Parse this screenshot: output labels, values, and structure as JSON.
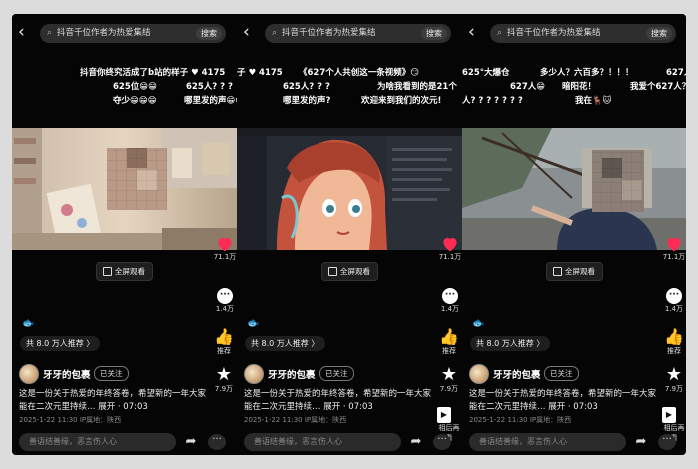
{
  "panels": [
    {
      "search": {
        "text": "抖音千位作者为热爱集结",
        "button": "搜索"
      },
      "danmu": [
        "抖音你终究活成了b站的样子 ♥ 4175",
        "625位😁😁",
        "夺少😁😁😁"
      ],
      "danmu_right": [
        "625人? ? ?",
        "哪里发的声😁😁"
      ],
      "fullscreen": "全屏观看",
      "rail": {
        "likes": "71.1万",
        "comments": "1.4万",
        "recommend": "推荐",
        "stars": "7.9万"
      },
      "fish": "🐟",
      "recommend_count": "共 8.0 万人推荐 〉",
      "author": "牙牙的包裹",
      "follow": "已关注",
      "desc": "这是一份关于热爱的年终答卷，希望新的一年大家能在二次元里持续…  展开  · 07:03",
      "meta": "2025-1-22 11:30  IP属地：陕西",
      "comment_placeholder": "善语结善缘，恶言伤人心"
    },
    {
      "search": {
        "text": "抖音千位作者为热爱集结",
        "button": "搜索"
      },
      "danmu": [
        "子 ♥ 4175",
        "625人? ? ?",
        "哪里发的声?"
      ],
      "danmu_right": [
        "《627个人共创这一条视频》😏",
        "为啥我看到的是21个",
        "欢迎来到我们的次元!"
      ],
      "fullscreen": "全屏观看",
      "rail": {
        "likes": "71.1万",
        "comments": "1.4万",
        "recommend": "推荐",
        "stars": "7.9万",
        "replay": "相后再看"
      },
      "fish": "🐟",
      "recommend_count": "共 8.0 万人推荐 〉",
      "author": "牙牙的包裹",
      "follow": "已关注",
      "desc": "这是一份关于热爱的年终答卷，希望新的一年大家能在二次元里持续…  展开  · 07:03",
      "meta": "2025-1-22 11:30  IP属地：陕西",
      "comment_placeholder": "善语结善缘，恶言伤人心"
    },
    {
      "search": {
        "text": "抖音千位作者为热爱集结",
        "button": "搜索"
      },
      "danmu": [
        "625°大爆仓",
        "多少人？六百多？！！！",
        "627人😁",
        "暗阳花！",
        "人? ? ? ? ? ? ?",
        "我在🦌🐱"
      ],
      "danmu_right": [
        "627人?",
        "我爱个627人？"
      ],
      "fullscreen": "全屏观看",
      "rail": {
        "likes": "71.1万",
        "comments": "1.4万",
        "recommend": "推荐",
        "stars": "7.9万",
        "replay": "相后再看"
      },
      "fish": "🐟",
      "recommend_count": "共 8.0 万人推荐 〉",
      "author": "牙牙的包裹",
      "follow": "已关注",
      "desc": "这是一份关于热爱的年终答卷，希望新的一年大家能在二次元里持续…  展开  · 07:03",
      "meta": "2025-1-22 11:30  IP属地：陕西",
      "comment_placeholder": "善语结善缘，恶言伤人心"
    }
  ],
  "colors": {
    "heart": "#fe2c55",
    "background": "#000000",
    "search_bg": "#2e2e2e"
  }
}
